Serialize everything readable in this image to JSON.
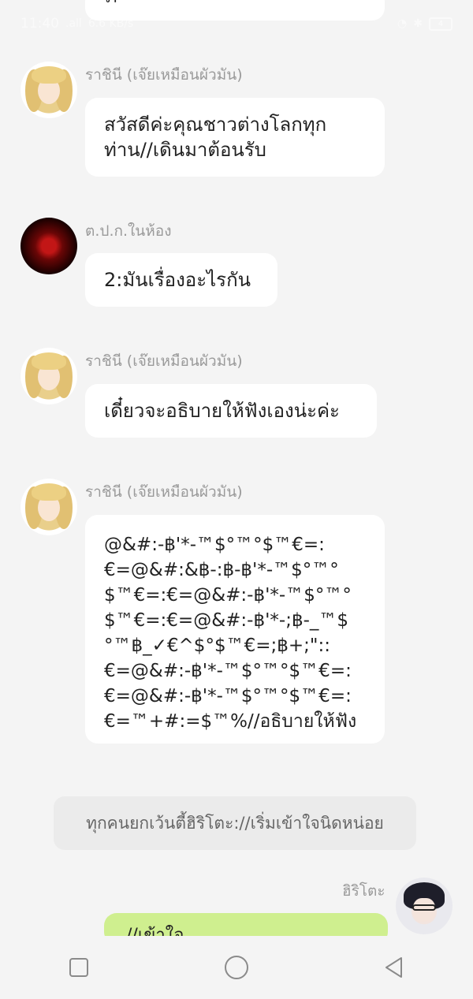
{
  "status_bar": {
    "time": "11:40",
    "signal_text": ".all",
    "network_speed": "6.6 KB/s",
    "battery_level": "4"
  },
  "top_partial": {
    "text": "ภ"
  },
  "messages": [
    {
      "sender": "ราชินี (เจ๊ยเหมือนผัวมัน)",
      "text": "สวัสดีค่ะคุณชาวต่างโลกทุก\nท่าน//เดินมาต้อนรับ"
    },
    {
      "sender": "ต.ป.ก.ในห้อง",
      "text": "2:มันเรื่องอะไรกัน"
    },
    {
      "sender": "ราชินี (เจ๊ยเหมือนผัวมัน)",
      "text": "เดี๋ยวจะอธิบายให้ฟังเองน่ะค่ะ"
    },
    {
      "sender": "ราชินี (เจ๊ยเหมือนผัวมัน)",
      "text": "@&#:-฿'*-™$°™°$™€=:\n€=@&#:&฿-:฿-฿'*-™$°™°\n$™€=:€=@&#:-฿'*-™$°™°\n$™€=:€=@&#:-฿'*-;฿-_™$\n°™฿_✓€^$°$™€=;฿+;\"::\n€=@&#:-฿'*-™$°™°$™€=:\n€=@&#:-฿'*-™$°™°$™€=:\n€=™+#:=$™%//อธิบายให้ฟัง"
    }
  ],
  "system_message": "ทุกคนยกเว้นตี้ฮิริโตะ://เริ่มเข้าใจนิดหน่อย",
  "own_message": {
    "sender": "ฮิริโตะ",
    "text": "//เข้าใจ"
  },
  "icons": {
    "avatar_queen": "blonde-anime-girl-avatar",
    "avatar_tpk": "red-orb-avatar",
    "avatar_hirito": "anime-boy-glasses-avatar",
    "nav_recent": "square-icon",
    "nav_home": "circle-icon",
    "nav_back": "triangle-back-icon"
  },
  "colors": {
    "background": "#f4f4f4",
    "bubble": "#ffffff",
    "own_bubble": "#cfef8f",
    "system_pill": "#ebebeb",
    "sender_name": "#9a9a9a"
  }
}
